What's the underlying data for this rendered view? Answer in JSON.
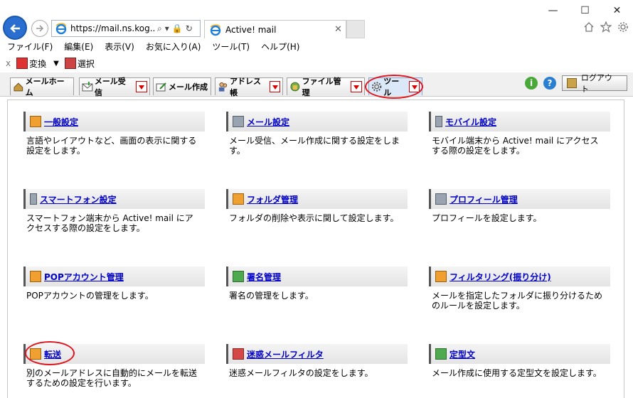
{
  "window": {
    "minimize": "—",
    "maximize": "☐",
    "close": "✕"
  },
  "browser": {
    "url": "https://mail.ns.kog...",
    "url_controls": [
      "⌕",
      "▾",
      "🔒",
      "↻"
    ],
    "tab_title": "Active! mail",
    "tab_close": "✕",
    "icons": [
      "home-icon",
      "star-icon",
      "gear-icon"
    ]
  },
  "menubar": {
    "items": [
      "ファイル(F)",
      "編集(E)",
      "表示(V)",
      "お気に入り(A)",
      "ツール(T)",
      "ヘルプ(H)"
    ]
  },
  "commandbar": {
    "close": "x",
    "convert": "変換",
    "select": "選択"
  },
  "apptabs": [
    {
      "label": "メールホーム",
      "dropdown": false
    },
    {
      "label": "メール受信",
      "dropdown": true
    },
    {
      "label": "メール作成",
      "dropdown": false
    },
    {
      "label": "アドレス帳",
      "dropdown": true
    },
    {
      "label": "ファイル管理",
      "dropdown": true
    },
    {
      "label": "ツール",
      "dropdown": true,
      "active": true
    }
  ],
  "header_right": {
    "info": "i",
    "help": "?",
    "logout": "ログアウト"
  },
  "settings": [
    {
      "title": "一般設定",
      "desc": "言語やレイアウトなど、画面の表示に関する設定をします。",
      "icon": "user-icon"
    },
    {
      "title": "メール設定",
      "desc": "メール受信、メール作成に関する設定をします。",
      "icon": "mail-settings-icon"
    },
    {
      "title": "モバイル設定",
      "desc": "モバイル端末から Active! mail にアクセスする際の設定をします。",
      "icon": "mobile-icon"
    },
    {
      "title": "スマートフォン設定",
      "desc": "スマートフォン端末から Active! mail にアクセスする際の設定をします。",
      "icon": "smartphone-icon"
    },
    {
      "title": "フォルダ管理",
      "desc": "フォルダの削除や表示に関して設定します。",
      "icon": "folder-icon"
    },
    {
      "title": "プロフィール管理",
      "desc": "プロフィールを設定します。",
      "icon": "profile-icon"
    },
    {
      "title": "POPアカウント管理",
      "desc": "POPアカウントの管理をします。",
      "icon": "pop-account-icon"
    },
    {
      "title": "署名管理",
      "desc": "署名の管理をします。",
      "icon": "pen-icon"
    },
    {
      "title": "フィルタリング(振り分け)",
      "desc": "メールを指定したフォルダに振り分けるためのルールを設定します。",
      "icon": "filter-icon"
    },
    {
      "title": "転送",
      "desc": "別のメールアドレスに自動的にメールを転送するための設定を行います。",
      "icon": "forward-icon"
    },
    {
      "title": "迷惑メールフィルタ",
      "desc": "迷惑メールフィルタの設定をします。",
      "icon": "spam-filter-icon"
    },
    {
      "title": "定型文",
      "desc": "メール作成に使用する定型文を設定します。",
      "icon": "template-icon"
    }
  ],
  "colors": {
    "link": "#0000c8",
    "highlight_circle": "#e0141e",
    "back_button": "#2a6fcf"
  }
}
